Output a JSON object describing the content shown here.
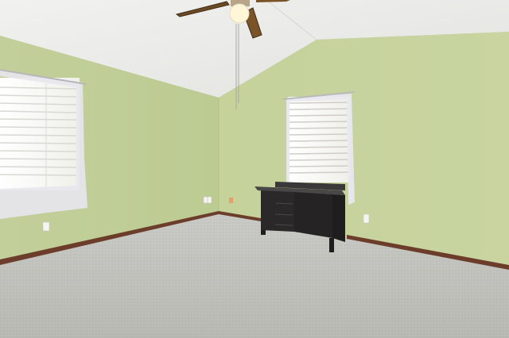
{
  "scene": {
    "description_visible_text": [],
    "colors": {
      "ceiling": "#eeeeec",
      "wall_left": "#c5d19b",
      "wall_right": "#c8d49c",
      "carpet": "#bfbfba",
      "baseboard": "#6b3d2a",
      "window_light": "#f7f7f2",
      "curtain": "#e9e8ef",
      "desk": "#2a2828",
      "fan_blade": "#6b4a24",
      "fan_light": "#fff6d8"
    },
    "icons": [
      "ceiling-fan-icon",
      "window-icon",
      "desk-icon",
      "outlet-icon"
    ]
  }
}
